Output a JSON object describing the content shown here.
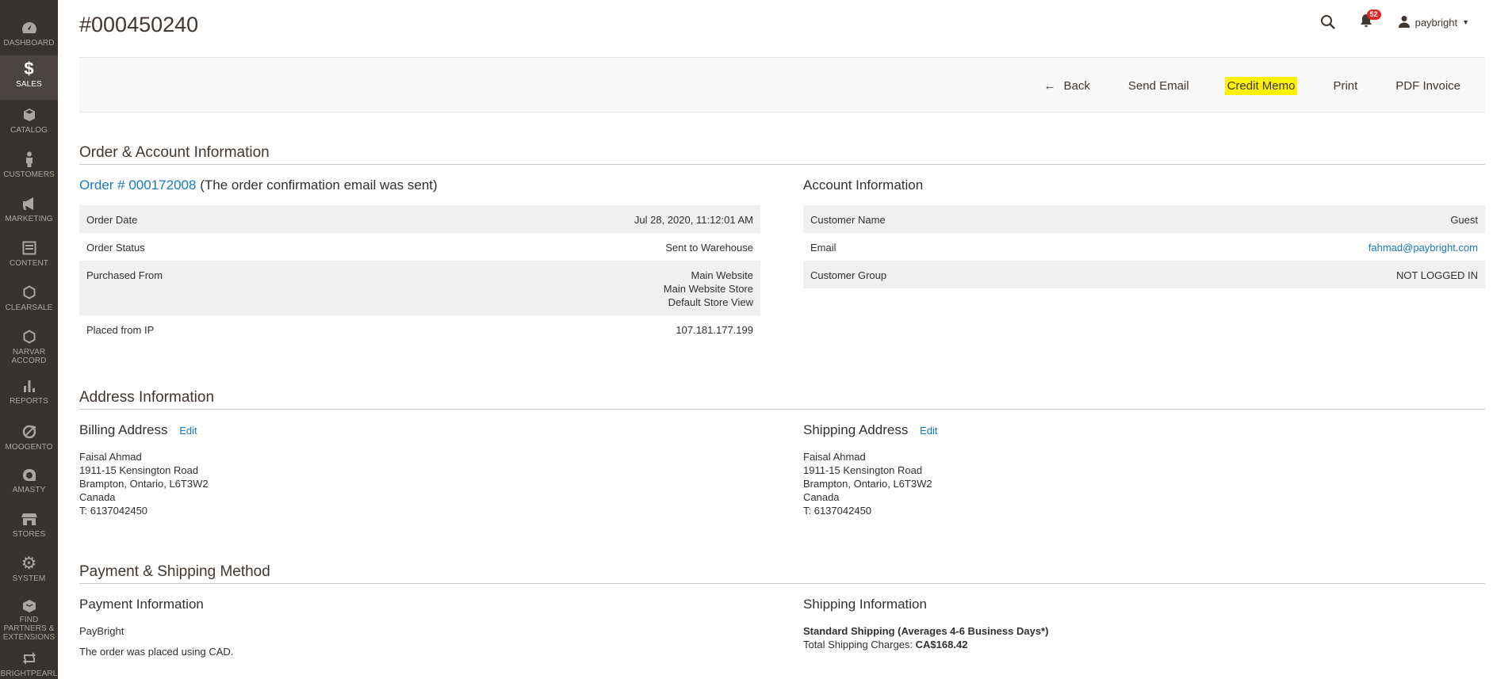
{
  "sidebar": {
    "items": [
      {
        "label": "Dashboard",
        "icon": "dashboard-icon"
      },
      {
        "label": "Sales",
        "icon": "dollar-icon",
        "active": true
      },
      {
        "label": "Catalog",
        "icon": "cube-icon"
      },
      {
        "label": "Customers",
        "icon": "person-icon"
      },
      {
        "label": "Marketing",
        "icon": "megaphone-icon"
      },
      {
        "label": "Content",
        "icon": "content-icon"
      },
      {
        "label": "Clearsale",
        "icon": "hexagon-icon"
      },
      {
        "label": "Narvar Accord",
        "icon": "hexagon-icon"
      },
      {
        "label": "Reports",
        "icon": "bar-chart-icon"
      },
      {
        "label": "Moogento",
        "icon": "moogento-icon"
      },
      {
        "label": "Amasty",
        "icon": "amasty-icon"
      },
      {
        "label": "Stores",
        "icon": "store-icon"
      },
      {
        "label": "System",
        "icon": "gear-icon"
      },
      {
        "label": "Find Partners & Extensions",
        "icon": "partners-icon"
      },
      {
        "label": "Brightpearl",
        "icon": "sync-icon"
      }
    ]
  },
  "header": {
    "title": "#000450240",
    "notifications": "52",
    "user": "paybright"
  },
  "actions": {
    "back": "Back",
    "send_email": "Send Email",
    "credit_memo": "Credit Memo",
    "print": "Print",
    "pdf_invoice": "PDF Invoice"
  },
  "order_account": {
    "section_title": "Order & Account Information",
    "order_link": "Order # 000172008",
    "order_note": "(The order confirmation email was sent)",
    "order_rows": [
      {
        "label": "Order Date",
        "value": "Jul 28, 2020, 11:12:01 AM"
      },
      {
        "label": "Order Status",
        "value": "Sent to Warehouse"
      },
      {
        "label": "Purchased From",
        "value_lines": [
          "Main Website",
          "Main Website Store",
          "Default Store View"
        ]
      },
      {
        "label": "Placed from IP",
        "value": "107.181.177.199"
      }
    ],
    "account_title": "Account Information",
    "account_rows": [
      {
        "label": "Customer Name",
        "value": "Guest"
      },
      {
        "label": "Email",
        "value": "fahmad@paybright.com"
      },
      {
        "label": "Customer Group",
        "value": "NOT LOGGED IN"
      }
    ]
  },
  "address": {
    "section_title": "Address Information",
    "edit": "Edit",
    "billing": {
      "title": "Billing Address",
      "lines": [
        "Faisal Ahmad",
        "1911-15 Kensington Road",
        "Brampton, Ontario, L6T3W2",
        "Canada",
        "T: 6137042450"
      ]
    },
    "shipping": {
      "title": "Shipping Address",
      "lines": [
        "Faisal Ahmad",
        "1911-15 Kensington Road",
        "Brampton, Ontario, L6T3W2",
        "Canada",
        "T: 6137042450"
      ]
    }
  },
  "payment_shipping": {
    "section_title": "Payment & Shipping Method",
    "payment_title": "Payment Information",
    "payment_method": "PayBright",
    "payment_note": "The order was placed using CAD.",
    "shipping_title": "Shipping Information",
    "shipping_method": "Standard Shipping (Averages 4-6 Business Days*)",
    "shipping_charges_label": "Total Shipping Charges:",
    "shipping_charges_value": "CA$168.42"
  }
}
